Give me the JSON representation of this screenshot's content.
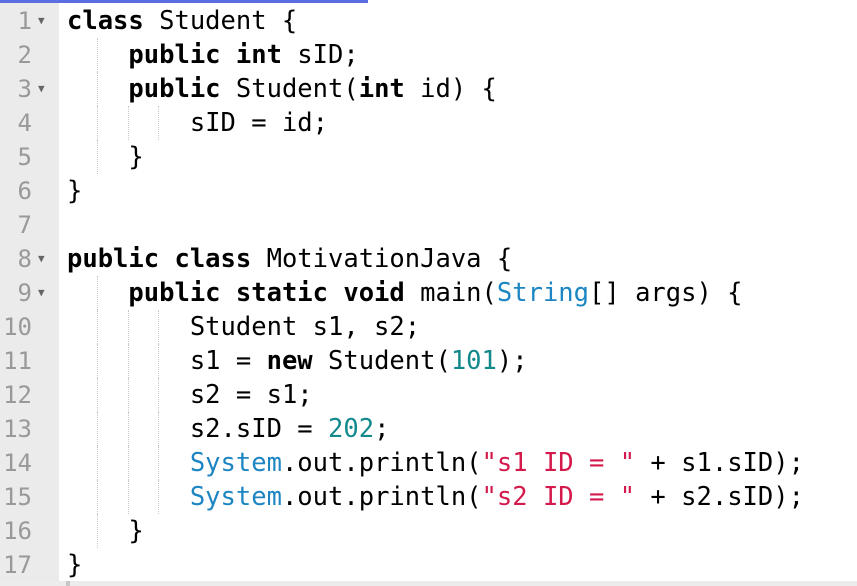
{
  "editor": {
    "lines": [
      {
        "n": "1",
        "fold": true,
        "indent": 0,
        "tokens": [
          [
            "kw",
            "class"
          ],
          [
            "",
            " Student {"
          ]
        ]
      },
      {
        "n": "2",
        "fold": false,
        "indent": 1,
        "tokens": [
          [
            "kw",
            "public int"
          ],
          [
            "",
            " sID;"
          ]
        ]
      },
      {
        "n": "3",
        "fold": true,
        "indent": 1,
        "tokens": [
          [
            "kw",
            "public"
          ],
          [
            "",
            " Student("
          ],
          [
            "kw",
            "int"
          ],
          [
            "",
            " id) {"
          ]
        ]
      },
      {
        "n": "4",
        "fold": false,
        "indent": 2,
        "tokens": [
          [
            "",
            "sID = id;"
          ]
        ]
      },
      {
        "n": "5",
        "fold": false,
        "indent": 1,
        "tokens": [
          [
            "",
            "}"
          ]
        ]
      },
      {
        "n": "6",
        "fold": false,
        "indent": 0,
        "tokens": [
          [
            "",
            "}"
          ]
        ]
      },
      {
        "n": "7",
        "fold": false,
        "indent": 0,
        "tokens": []
      },
      {
        "n": "8",
        "fold": true,
        "indent": 0,
        "tokens": [
          [
            "kw",
            "public class"
          ],
          [
            "",
            " MotivationJava {"
          ]
        ]
      },
      {
        "n": "9",
        "fold": true,
        "indent": 1,
        "tokens": [
          [
            "kw",
            "public static void"
          ],
          [
            "",
            " main("
          ],
          [
            "type",
            "String"
          ],
          [
            "",
            "[] args) {"
          ]
        ]
      },
      {
        "n": "10",
        "fold": false,
        "indent": 2,
        "tokens": [
          [
            "",
            "Student s1, s2;"
          ]
        ]
      },
      {
        "n": "11",
        "fold": false,
        "indent": 2,
        "tokens": [
          [
            "",
            "s1 = "
          ],
          [
            "kw",
            "new"
          ],
          [
            "",
            " Student("
          ],
          [
            "num",
            "101"
          ],
          [
            "",
            ");"
          ]
        ]
      },
      {
        "n": "12",
        "fold": false,
        "indent": 2,
        "tokens": [
          [
            "",
            "s2 = s1;"
          ]
        ]
      },
      {
        "n": "13",
        "fold": false,
        "indent": 2,
        "tokens": [
          [
            "",
            "s2.sID = "
          ],
          [
            "num",
            "202"
          ],
          [
            "",
            ";"
          ]
        ]
      },
      {
        "n": "14",
        "fold": false,
        "indent": 2,
        "tokens": [
          [
            "type",
            "System"
          ],
          [
            "",
            ".out.println("
          ],
          [
            "str",
            "\"s1 ID = \""
          ],
          [
            "",
            " + s1.sID);"
          ]
        ]
      },
      {
        "n": "15",
        "fold": false,
        "indent": 2,
        "tokens": [
          [
            "type",
            "System"
          ],
          [
            "",
            ".out.println("
          ],
          [
            "str",
            "\"s2 ID = \""
          ],
          [
            "",
            " + s2.sID);"
          ]
        ]
      },
      {
        "n": "16",
        "fold": false,
        "indent": 1,
        "tokens": [
          [
            "",
            "}"
          ]
        ]
      },
      {
        "n": "17",
        "fold": false,
        "indent": 0,
        "tokens": [
          [
            "",
            "}"
          ]
        ]
      }
    ]
  }
}
